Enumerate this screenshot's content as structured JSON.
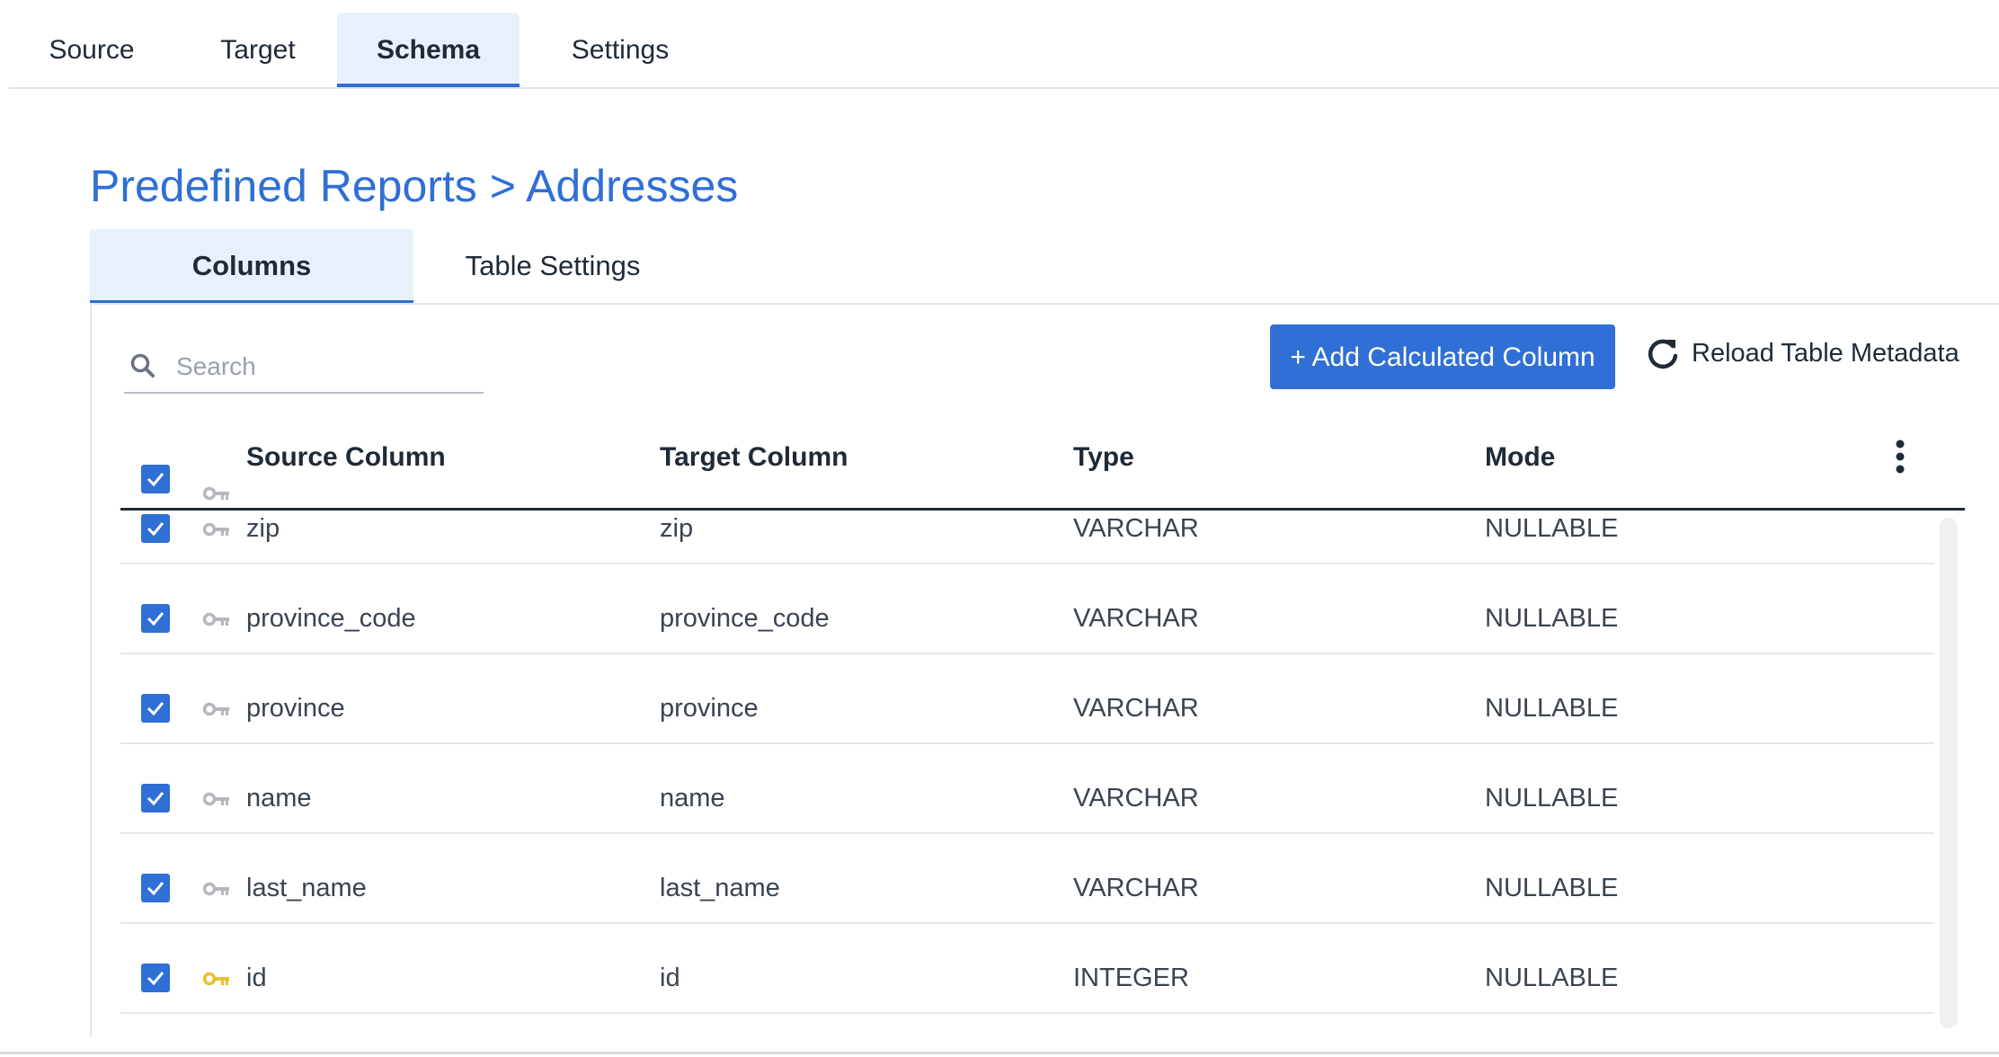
{
  "top_tabs": [
    {
      "label": "Source"
    },
    {
      "label": "Target"
    },
    {
      "label": "Schema",
      "active": true
    },
    {
      "label": "Settings"
    }
  ],
  "breadcrumb": {
    "parent": "Predefined Reports",
    "separator": ">",
    "current": "Addresses"
  },
  "sub_tabs": [
    {
      "label": "Columns",
      "active": true
    },
    {
      "label": "Table Settings"
    }
  ],
  "search": {
    "placeholder": "Search",
    "icon": "search-icon"
  },
  "buttons": {
    "add_calculated_column": "+ Add Calculated Column",
    "reload_table_metadata": "Reload Table Metadata",
    "reload_icon": "refresh-icon"
  },
  "table": {
    "headers": {
      "source": "Source Column",
      "target": "Target Column",
      "type": "Type",
      "mode": "Mode"
    },
    "select_all_checked": true,
    "rows": [
      {
        "source": "zip",
        "target": "zip",
        "type": "VARCHAR",
        "mode": "NULLABLE",
        "checked": true,
        "primary_key": false
      },
      {
        "source": "province_code",
        "target": "province_code",
        "type": "VARCHAR",
        "mode": "NULLABLE",
        "checked": true,
        "primary_key": false
      },
      {
        "source": "province",
        "target": "province",
        "type": "VARCHAR",
        "mode": "NULLABLE",
        "checked": true,
        "primary_key": false
      },
      {
        "source": "name",
        "target": "name",
        "type": "VARCHAR",
        "mode": "NULLABLE",
        "checked": true,
        "primary_key": false
      },
      {
        "source": "last_name",
        "target": "last_name",
        "type": "VARCHAR",
        "mode": "NULLABLE",
        "checked": true,
        "primary_key": false
      },
      {
        "source": "id",
        "target": "id",
        "type": "INTEGER",
        "mode": "NULLABLE",
        "checked": true,
        "primary_key": true
      }
    ]
  },
  "colors": {
    "accent": "#2f6fd6",
    "active_tab_bg": "#e8f1fb",
    "key_inactive": "#b4b8bd",
    "key_primary": "#e8c12c"
  }
}
